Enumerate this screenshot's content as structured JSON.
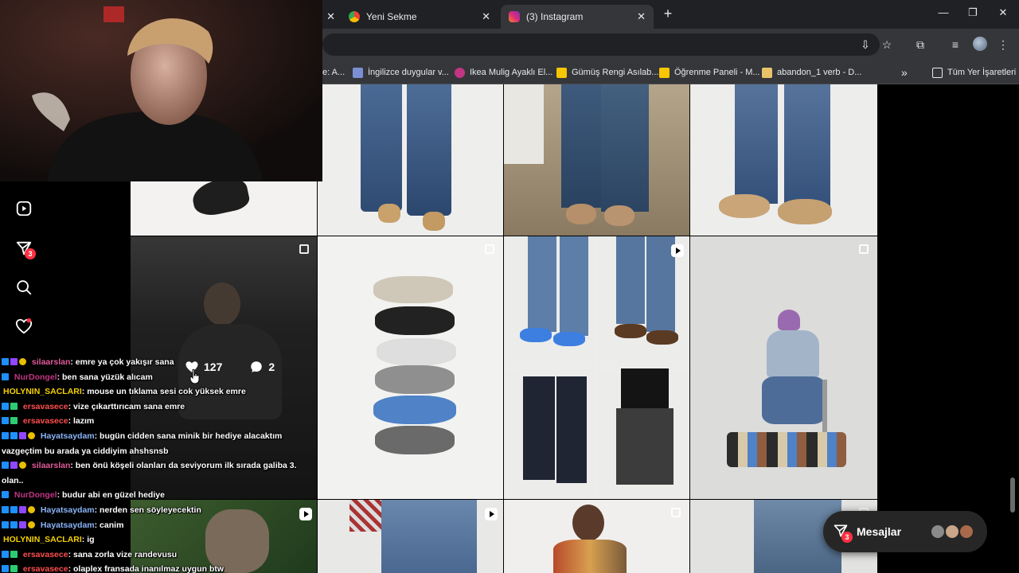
{
  "browser": {
    "tabs": [
      {
        "title": "Yeni Sekme",
        "active": false
      },
      {
        "title": "(3) Instagram",
        "active": true
      }
    ],
    "bookmarks": [
      {
        "label": "e: A...",
        "color": "#8ab4f8"
      },
      {
        "label": "İngilizce duygular v...",
        "color": "#7a8fd4"
      },
      {
        "label": "Ikea Mulig Ayaklı El...",
        "color": "#c13584"
      },
      {
        "label": "Gümüş Rengi Asılab...",
        "color": "#f6c700"
      },
      {
        "label": "Öğrenme Paneli - M...",
        "color": "#f6c700"
      },
      {
        "label": "abandon_1 verb - D...",
        "color": "#e8c36a"
      }
    ],
    "all_bookmarks_label": "Tüm Yer İşaretleri"
  },
  "instagram": {
    "nav_icons": [
      "reels-icon",
      "messages-icon",
      "search-icon",
      "notifications-icon"
    ],
    "messages_badge": "3",
    "hovered_post_stats": {
      "likes": "127",
      "comments": "2"
    },
    "messages_pill": {
      "label": "Mesajlar",
      "badge": "3"
    }
  },
  "chat": [
    {
      "user": "silaarslan",
      "color": "#e05a9a",
      "text": ": emre ya çok yakışır sana"
    },
    {
      "user": "NurDongel",
      "color": "#c13584",
      "text": ": ben sana yüzük alıcam"
    },
    {
      "user": "HOLYNIN_SACLARI",
      "color": "#f5d000",
      "text": ": mouse un tıklama sesi cok yüksek emre"
    },
    {
      "user": "ersavasece",
      "color": "#ff4d4d",
      "text": ": vize çıkarttırıcam sana emre"
    },
    {
      "user": "ersavasece",
      "color": "#ff4d4d",
      "text": ": lazım"
    },
    {
      "user": "Hayatsaydam",
      "color": "#8ab4f8",
      "text": ": bugün cidden sana minik bir hediye alacaktım vazgeçtim bu arada ya ciddiyim ahshsnsb"
    },
    {
      "user": "silaarslan",
      "color": "#e05a9a",
      "text": ": ben önü köşeli olanları da seviyorum ilk sırada galiba 3. olan.."
    },
    {
      "user": "NurDongel",
      "color": "#c13584",
      "text": ": budur abi en güzel hediye"
    },
    {
      "user": "Hayatsaydam",
      "color": "#8ab4f8",
      "text": ": nerden sen söyleyecektin"
    },
    {
      "user": "Hayatsaydam",
      "color": "#8ab4f8",
      "text": ": canim"
    },
    {
      "user": "HOLYNIN_SACLARI",
      "color": "#f5d000",
      "text": ": ig"
    },
    {
      "user": "ersavasece",
      "color": "#ff4d4d",
      "text": ": sana zorla vize randevusu"
    },
    {
      "user": "ersavasece",
      "color": "#ff4d4d",
      "text": ": olaplex fransada inanılmaz uygun btw"
    }
  ]
}
